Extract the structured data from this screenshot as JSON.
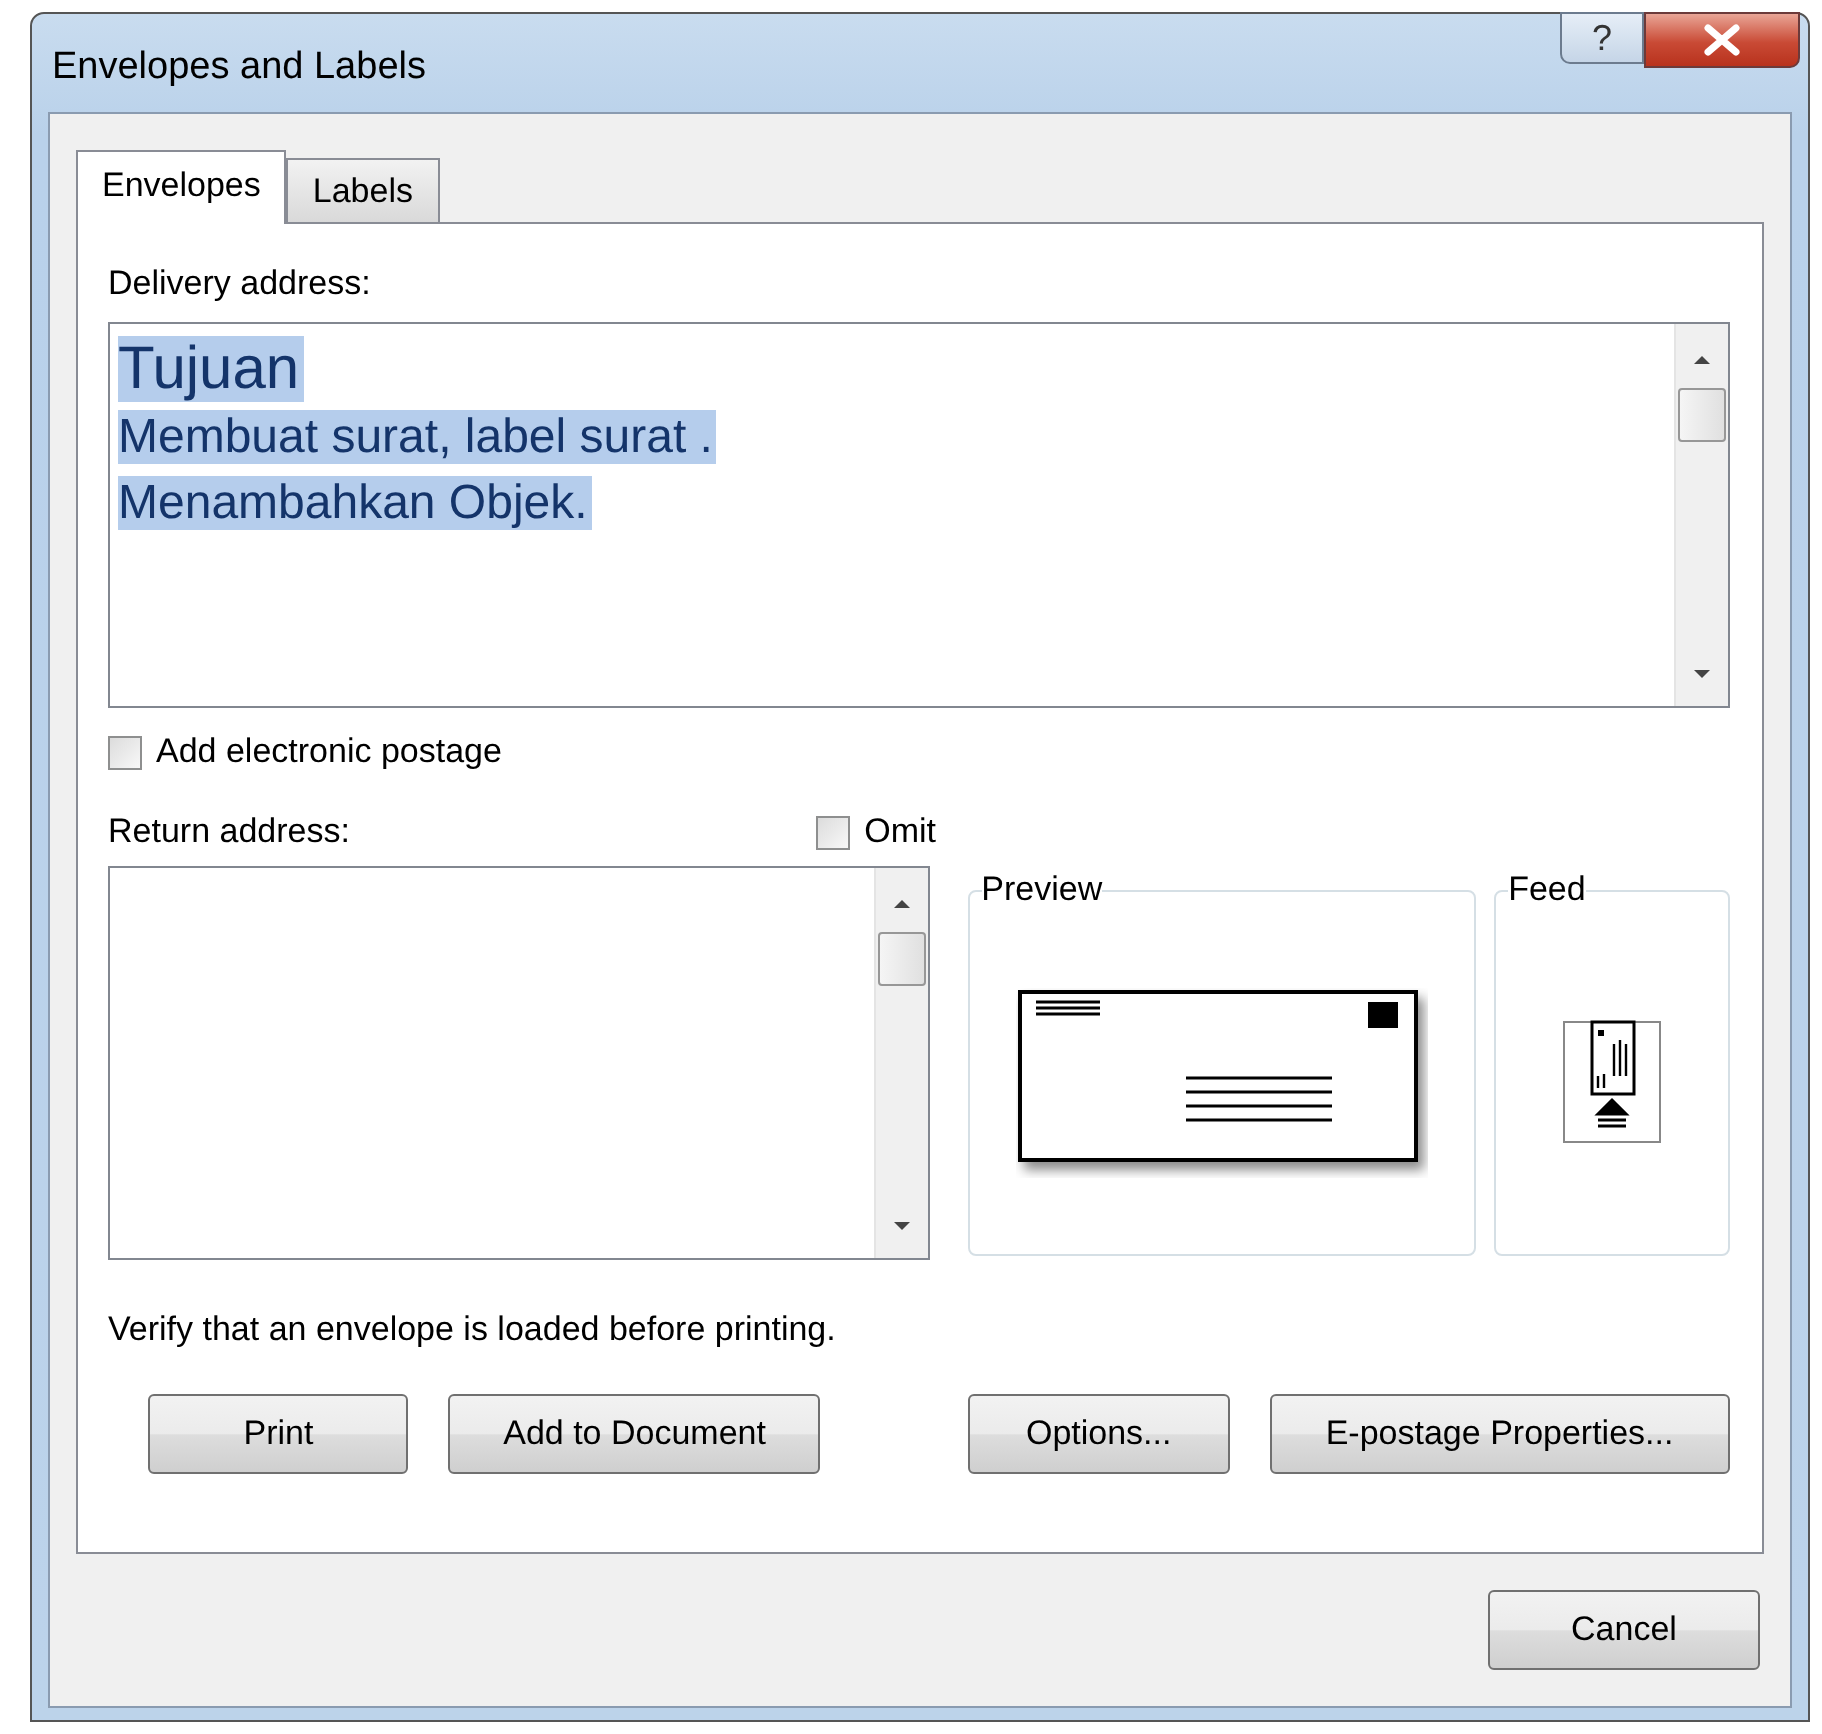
{
  "window": {
    "title": "Envelopes and Labels",
    "help_button": "?"
  },
  "tabs": [
    {
      "label": "Envelopes",
      "selected": true
    },
    {
      "label": "Labels",
      "selected": false
    }
  ],
  "delivery_address": {
    "label": "Delivery address:",
    "selected": true,
    "lines": [
      {
        "text": "Tujuan",
        "kind": "heading"
      },
      {
        "text": "Membuat surat, label surat .",
        "kind": "body"
      },
      {
        "text": "Menambahkan Objek.",
        "kind": "body"
      }
    ]
  },
  "electronic_postage": {
    "label": "Add electronic postage",
    "checked": false
  },
  "return_address": {
    "label": "Return address:",
    "omit": {
      "label": "Omit",
      "checked": false
    }
  },
  "preview": {
    "label": "Preview"
  },
  "feed": {
    "label": "Feed"
  },
  "note": "Verify that an envelope is loaded before printing.",
  "buttons": [
    {
      "label": "Print"
    },
    {
      "label": "Add to Document"
    },
    {
      "label": "Options..."
    },
    {
      "label": "E-postage Properties..."
    }
  ],
  "cancel_button": "Cancel"
}
